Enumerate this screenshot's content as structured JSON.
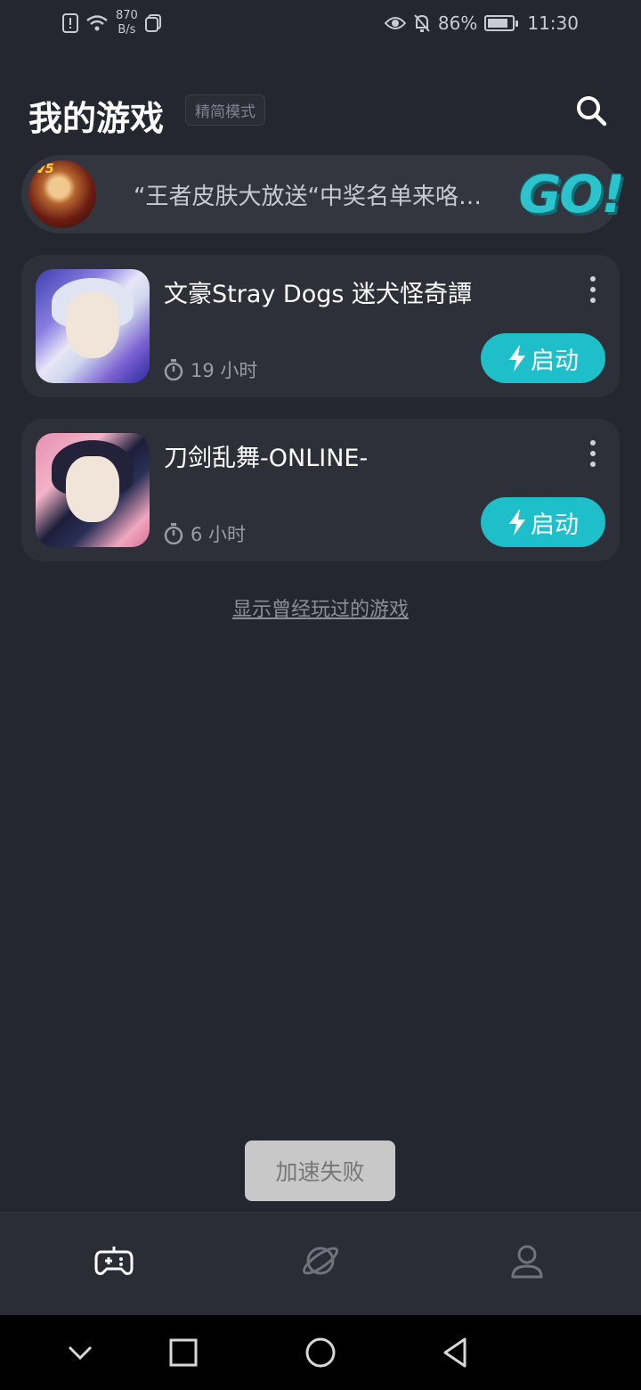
{
  "status_bar": {
    "net_speed_value": "870",
    "net_speed_unit": "B/s",
    "battery_percent": "86%",
    "battery_level": 0.86,
    "time": "11:30",
    "icons": [
      "alert-icon",
      "wifi-icon",
      "sim-icon",
      "eye-icon",
      "bell-off-icon",
      "battery-icon"
    ]
  },
  "header": {
    "title": "我的游戏",
    "mode_tag": "精简模式",
    "search_icon": "search-icon"
  },
  "banner": {
    "text": "“王者皮肤大放送“中奖名单来咯…",
    "avatar_badge": "V5",
    "go_label": "GO!",
    "accent_color": "#2bc4cc"
  },
  "games": [
    {
      "title": "文豪Stray Dogs 迷犬怪奇譚",
      "playtime": "19 小时",
      "launch_label": "启动"
    },
    {
      "title": "刀剑乱舞-ONLINE-",
      "playtime": "6 小时",
      "launch_label": "启动"
    }
  ],
  "history_link": "显示曾经玩过的游戏",
  "toast": "加速失败",
  "bottom_nav": {
    "items": [
      "gamepad-icon",
      "planet-icon",
      "profile-icon"
    ],
    "active_index": 0
  },
  "colors": {
    "background": "#252730",
    "card": "#2e3039",
    "accent": "#1fbfca"
  }
}
